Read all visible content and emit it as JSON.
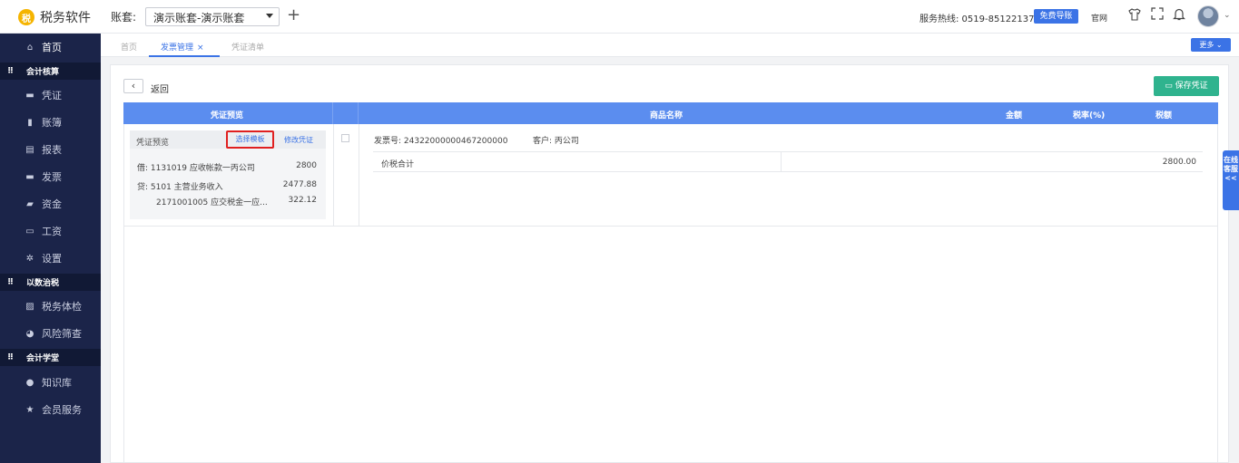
{
  "app": {
    "logo_glyph": "税",
    "name": "税务软件"
  },
  "header": {
    "account_label": "账套:",
    "account_value": "演示账套-演示账套",
    "hotline": "服务热线: 0519-85122137",
    "free_nav": "免费导账",
    "official": "官网"
  },
  "sidebar": {
    "home": "首页",
    "group1": "会计核算",
    "g1_items": [
      "凭证",
      "账簿",
      "报表",
      "发票",
      "资金",
      "工资",
      "设置"
    ],
    "group2": "以数治税",
    "g2_items": [
      "税务体检",
      "风险筛查"
    ],
    "group3": "会计学堂",
    "g3_items": [
      "知识库",
      "会员服务"
    ]
  },
  "tabs": {
    "home": "首页",
    "invoice": "发票管理",
    "close": "×",
    "voucher_list": "凭证清单",
    "more": "更多 ⌄"
  },
  "toolbar": {
    "back_glyph": "‹",
    "back": "返回",
    "save": "保存凭证"
  },
  "table": {
    "headers": {
      "preview": "凭证预览",
      "product": "商品名称",
      "amount": "金额",
      "tax_rate": "税率(%)",
      "tax": "税额"
    }
  },
  "preview": {
    "title": "凭证预览",
    "choose_template": "选择模板",
    "edit_voucher": "修改凭证",
    "lines": [
      {
        "text": "借: 1131019 应收帐款一丙公司",
        "amount": "2800"
      },
      {
        "text": "贷: 5101 主营业务收入",
        "amount": "2477.88"
      },
      {
        "text": "2171001005 应交税金一应...",
        "amount": "322.12"
      }
    ]
  },
  "invoice": {
    "number": "发票号: 24322000000467200000",
    "customer": "客户: 丙公司",
    "total_label": "价税合计",
    "total_value": "2800.00"
  },
  "online_service": "在线客服<<"
}
